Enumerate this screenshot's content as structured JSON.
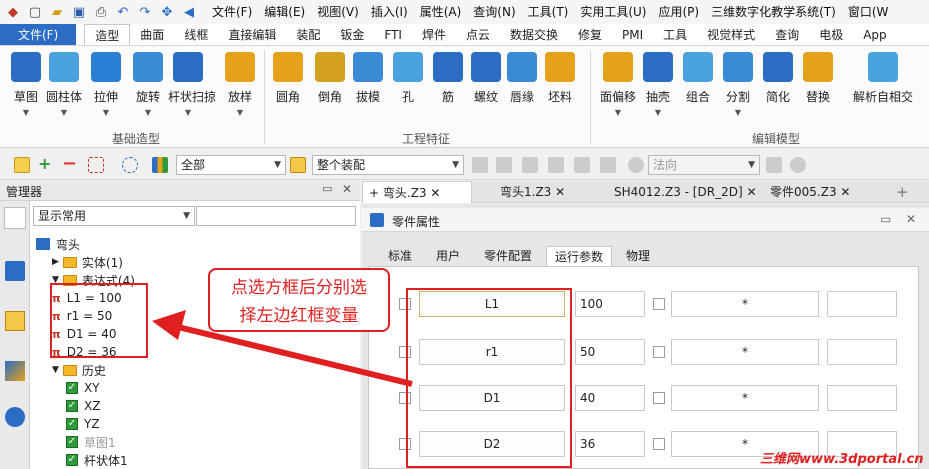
{
  "menubar": [
    "文件(F)",
    "编辑(E)",
    "视图(V)",
    "插入(I)",
    "属性(A)",
    "查询(N)",
    "工具(T)",
    "实用工具(U)",
    "应用(P)",
    "三维数字化教学系统(T)",
    "窗口(W"
  ],
  "ribbon_tabs": [
    "文件(F)",
    "造型",
    "曲面",
    "线框",
    "直接编辑",
    "装配",
    "钣金",
    "FTI",
    "焊件",
    "点云",
    "数据交换",
    "修复",
    "PMI",
    "工具",
    "视觉样式",
    "查询",
    "电极",
    "App"
  ],
  "ribbon_buttons": [
    "草图",
    "圆柱体",
    "拉伸",
    "旋转",
    "杆状扫掠",
    "放样",
    "圆角",
    "倒角",
    "拔模",
    "孔",
    "筋",
    "螺纹",
    "唇缘",
    "坯料",
    "面偏移",
    "抽壳",
    "组合",
    "分割",
    "简化",
    "替换",
    "解析自相交"
  ],
  "ribbon_groups": [
    "基础造型",
    "工程特征",
    "编辑模型"
  ],
  "toolbar": {
    "filter_value": "全部",
    "assembly_value": "整个装配",
    "direction_placeholder": "法向"
  },
  "left_panel": {
    "title": "管理器",
    "filter": "显示常用",
    "tree": [
      {
        "label": "弯头",
        "kind": "root"
      },
      {
        "label": "实体(1)",
        "kind": "folder"
      },
      {
        "label": "表达式(4)",
        "kind": "folder"
      },
      {
        "label": "L1 = 100",
        "kind": "expr"
      },
      {
        "label": "r1 = 50",
        "kind": "expr"
      },
      {
        "label": "D1 = 40",
        "kind": "expr"
      },
      {
        "label": "D2 = 36",
        "kind": "expr"
      },
      {
        "label": "历史",
        "kind": "folder"
      },
      {
        "label": "XY",
        "kind": "check"
      },
      {
        "label": "XZ",
        "kind": "check"
      },
      {
        "label": "YZ",
        "kind": "check"
      },
      {
        "label": "草图1",
        "kind": "check"
      },
      {
        "label": "杆状体1",
        "kind": "check"
      }
    ]
  },
  "doc_tabs": [
    "弯头.Z3",
    "弯头1.Z3",
    "SH4012.Z3 - [DR_2D]",
    "零件005.Z3"
  ],
  "properties": {
    "title": "零件属性",
    "tabs": [
      "标准",
      "用户",
      "零件配置",
      "运行参数",
      "物理"
    ],
    "active_tab": "运行参数",
    "rows": [
      {
        "name": "L1",
        "value": "100",
        "star": "*"
      },
      {
        "name": "r1",
        "value": "50",
        "star": "*"
      },
      {
        "name": "D1",
        "value": "40",
        "star": "*"
      },
      {
        "name": "D2",
        "value": "36",
        "star": "*"
      }
    ]
  },
  "annotation": {
    "line1": "点选方框后分别选",
    "line2": "择左边红框变量"
  },
  "watermark": "三维网www.3dportal.cn",
  "colors": {
    "accent": "#2b6cc4",
    "annotation": "#e02020",
    "checkbox": "#2f9a3a"
  }
}
